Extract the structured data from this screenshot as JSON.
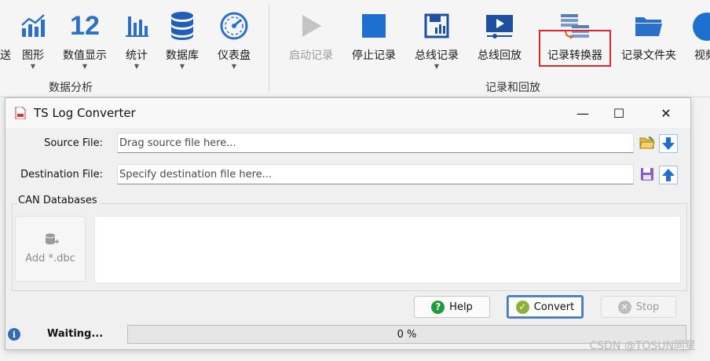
{
  "ribbon": {
    "partial_left_label": "送",
    "partial_right_label": "视频",
    "groups": {
      "data_analysis": "数据分析",
      "record_playback": "记录和回放"
    },
    "buttons": {
      "graphics": "图形",
      "numeric_display": "数值显示",
      "numeric_icon_text": "12",
      "statistics": "统计",
      "database": "数据库",
      "dashboard": "仪表盘",
      "start_record": "启动记录",
      "stop_record": "停止记录",
      "bus_record": "总线记录",
      "bus_playback": "总线回放",
      "log_converter": "记录转换器",
      "log_folder": "记录文件夹"
    }
  },
  "dialog": {
    "title": "TS Log Converter",
    "window_controls": {
      "minimize": "—",
      "maximize": "☐",
      "close": "✕"
    },
    "source": {
      "label": "Source File:",
      "value": "",
      "placeholder": "Drag source file here..."
    },
    "destination": {
      "label": "Destination File:",
      "value": "",
      "placeholder": "Specify destination file here..."
    },
    "can_databases": {
      "title": "CAN Databases",
      "add_label": "Add *.dbc"
    },
    "buttons": {
      "help": "Help",
      "convert": "Convert",
      "stop": "Stop"
    }
  },
  "status": {
    "text": "Waiting...",
    "progress_percent": 0,
    "progress_label": "0 %"
  },
  "watermark": "CSDN @TOSUN同星",
  "colors": {
    "accent_blue": "#1f6fd0",
    "highlight_red": "#e0262a",
    "help_green": "#1f9a3a",
    "convert_olive": "#8bb13a",
    "progress_green": "#06b025"
  }
}
